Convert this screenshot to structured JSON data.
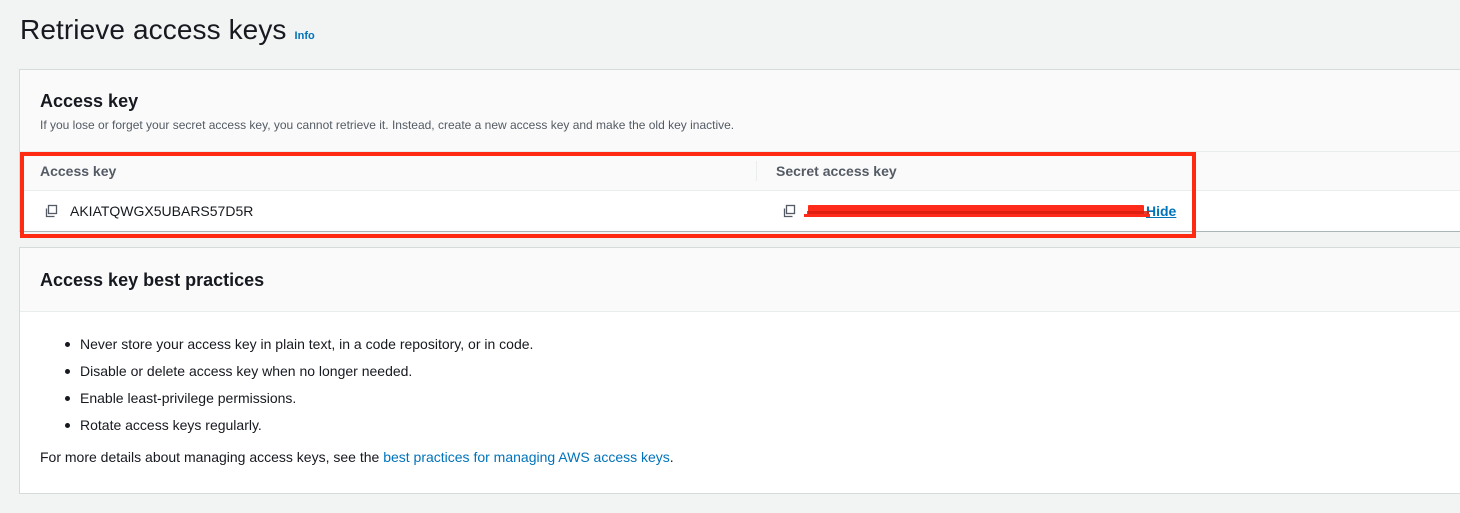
{
  "header": {
    "title": "Retrieve access keys",
    "info_label": "Info"
  },
  "access_key_panel": {
    "title": "Access key",
    "description": "If you lose or forget your secret access key, you cannot retrieve it. Instead, create a new access key and make the old key inactive.",
    "table": {
      "columns": [
        "Access key",
        "Secret access key"
      ],
      "row": {
        "access_key": "AKIATQWGX5UBARS57D5R",
        "secret_key_redacted": true,
        "hide_label": "Hide"
      }
    }
  },
  "best_practices_panel": {
    "title": "Access key best practices",
    "items": [
      "Never store your access key in plain text, in a code repository, or in code.",
      "Disable or delete access key when no longer needed.",
      "Enable least-privilege permissions.",
      "Rotate access keys regularly."
    ],
    "more_details_prefix": "For more details about managing access keys, see the ",
    "more_details_link": "best practices for managing AWS access keys",
    "more_details_suffix": "."
  },
  "colors": {
    "link": "#0073bb",
    "highlight": "#ff2a12",
    "redaction": "#ff2b1a",
    "page_background": "#f2f3f3"
  },
  "icons": {
    "copy": "copy-icon"
  }
}
